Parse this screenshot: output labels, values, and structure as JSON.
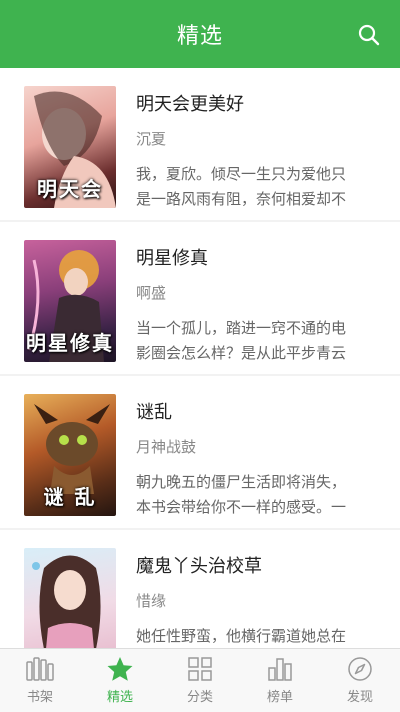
{
  "header": {
    "title": "精选"
  },
  "books": [
    {
      "title": "明天会更美好",
      "author": "沉夏",
      "desc_line1": "我，夏欣。倾尽一生只为爱他只",
      "desc_line2": "是一路风雨有阻，奈何相爱却不",
      "cover_text": "明天会",
      "cover_colors": [
        "#f3c7c0",
        "#7a3b3b"
      ]
    },
    {
      "title": "明星修真",
      "author": "啊盛",
      "desc_line1": "当一个孤儿，踏进一窍不通的电",
      "desc_line2": "影圈会怎么样？是从此平步青云",
      "cover_text": "明星修真",
      "cover_colors": [
        "#b25a8a",
        "#2f1d3f"
      ]
    },
    {
      "title": "谜乱",
      "author": "月神战鼓",
      "desc_line1": "朝九晚五的僵尸生活即将消失，",
      "desc_line2": "本书会带给你不一样的感受。一",
      "cover_text": "谜 乱",
      "cover_colors": [
        "#d08a3c",
        "#3a2416"
      ]
    },
    {
      "title": "魔鬼丫头治校草",
      "author": "惜缘",
      "desc_line1": "她任性野蛮，他横行霸道她总在",
      "desc_line2": "",
      "cover_text": "",
      "cover_colors": [
        "#dbeef6",
        "#e9b7c8"
      ]
    }
  ],
  "tabs": [
    {
      "label": "书架",
      "icon": "bookshelf-icon",
      "active": false
    },
    {
      "label": "精选",
      "icon": "star-icon",
      "active": true
    },
    {
      "label": "分类",
      "icon": "grid-icon",
      "active": false
    },
    {
      "label": "榜单",
      "icon": "bar-chart-icon",
      "active": false
    },
    {
      "label": "发现",
      "icon": "compass-icon",
      "active": false
    }
  ],
  "colors": {
    "accent": "#3fb34f",
    "inactive": "#888888"
  }
}
